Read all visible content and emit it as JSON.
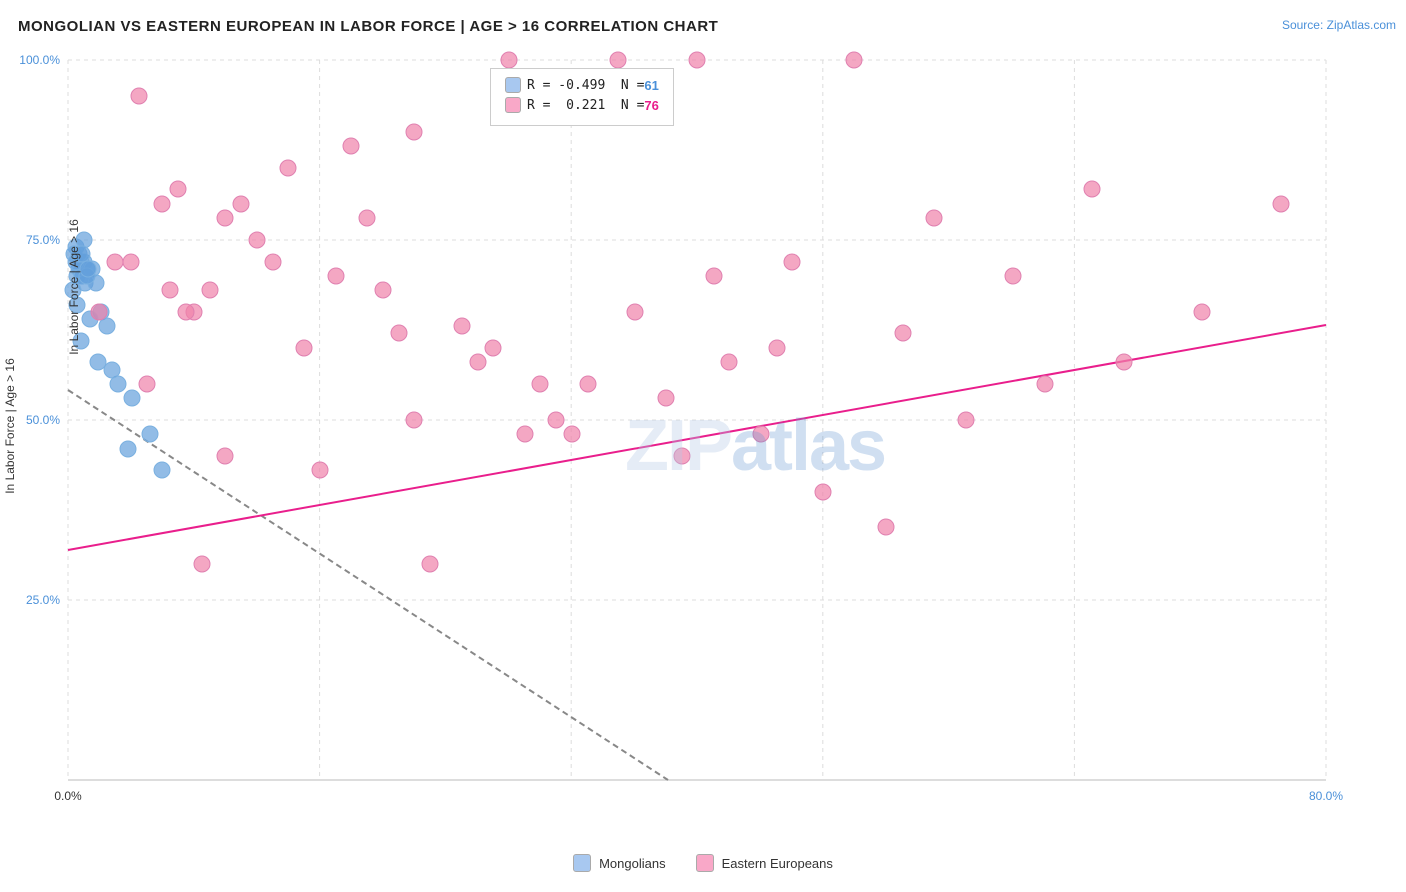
{
  "title": "MONGOLIAN VS EASTERN EUROPEAN IN LABOR FORCE | AGE > 16 CORRELATION CHART",
  "source": "Source: ZipAtlas.com",
  "yAxisLabel": "In Labor Force | Age > 16",
  "xAxisLabel": "",
  "yTicks": [
    "100.0%",
    "75.0%",
    "50.0%",
    "25.0%",
    ""
  ],
  "xTicks": [
    "0.0%",
    "",
    "",
    "",
    "",
    "80.0%"
  ],
  "legend": {
    "row1": {
      "r": "R = -0.499",
      "n": "N = 61",
      "color": "#a8c8f0"
    },
    "row2": {
      "r": "R =  0.221",
      "n": "N = 76",
      "color": "#f9a8c8"
    }
  },
  "watermark": "ZIPatlas",
  "footer": {
    "mongolians_label": "Mongolians",
    "eastern_europeans_label": "Eastern Europeans",
    "mongolians_color": "#a8c8f0",
    "eastern_europeans_color": "#f9a8c8"
  },
  "mongolian_points": [
    [
      0.5,
      78
    ],
    [
      0.8,
      76
    ],
    [
      0.6,
      74
    ],
    [
      1.0,
      72
    ],
    [
      0.7,
      76
    ],
    [
      1.2,
      75
    ],
    [
      0.9,
      73
    ],
    [
      1.5,
      74
    ],
    [
      1.1,
      71
    ],
    [
      0.4,
      77
    ],
    [
      0.3,
      68
    ],
    [
      0.6,
      66
    ],
    [
      1.8,
      69
    ],
    [
      2.1,
      65
    ],
    [
      1.4,
      64
    ],
    [
      0.8,
      61
    ],
    [
      2.5,
      63
    ],
    [
      1.9,
      58
    ],
    [
      3.2,
      55
    ],
    [
      2.8,
      57
    ],
    [
      1.2,
      70
    ],
    [
      0.5,
      72
    ],
    [
      4.1,
      52
    ],
    [
      5.2,
      48
    ],
    [
      3.8,
      46
    ],
    [
      6.0,
      43
    ],
    [
      1.0,
      75
    ],
    [
      0.7,
      79
    ],
    [
      0.9,
      77
    ],
    [
      1.3,
      73
    ]
  ],
  "eastern_european_points": [
    [
      4.5,
      95
    ],
    [
      28.0,
      100
    ],
    [
      14.0,
      85
    ],
    [
      6.0,
      80
    ],
    [
      10.0,
      78
    ],
    [
      7.0,
      82
    ],
    [
      18.0,
      88
    ],
    [
      22.0,
      90
    ],
    [
      35.0,
      92
    ],
    [
      40.0,
      100
    ],
    [
      50.0,
      100
    ],
    [
      55.0,
      78
    ],
    [
      60.0,
      70
    ],
    [
      65.0,
      82
    ],
    [
      12.0,
      75
    ],
    [
      15.0,
      60
    ],
    [
      8.0,
      65
    ],
    [
      20.0,
      68
    ],
    [
      25.0,
      63
    ],
    [
      30.0,
      55
    ],
    [
      32.0,
      48
    ],
    [
      38.0,
      52
    ],
    [
      42.0,
      58
    ],
    [
      45.0,
      60
    ],
    [
      48.0,
      40
    ],
    [
      52.0,
      35
    ],
    [
      10.0,
      45
    ],
    [
      16.0,
      42
    ],
    [
      22.0,
      50
    ],
    [
      5.0,
      55
    ],
    [
      9.0,
      68
    ],
    [
      13.0,
      72
    ],
    [
      17.0,
      70
    ],
    [
      21.0,
      62
    ],
    [
      26.0,
      58
    ],
    [
      31.0,
      50
    ],
    [
      36.0,
      65
    ],
    [
      41.0,
      70
    ],
    [
      46.0,
      72
    ],
    [
      3.0,
      72
    ],
    [
      7.5,
      65
    ],
    [
      11.0,
      80
    ],
    [
      19.0,
      78
    ],
    [
      27.0,
      60
    ],
    [
      33.0,
      55
    ],
    [
      39.0,
      45
    ],
    [
      44.0,
      48
    ],
    [
      8.5,
      28
    ],
    [
      23.0,
      28
    ],
    [
      29.0,
      48
    ],
    [
      2.0,
      65
    ],
    [
      4.0,
      72
    ],
    [
      6.5,
      68
    ],
    [
      53.0,
      62
    ],
    [
      57.0,
      50
    ],
    [
      62.0,
      55
    ],
    [
      67.0,
      58
    ],
    [
      72.0,
      65
    ],
    [
      77.0,
      80
    ]
  ]
}
